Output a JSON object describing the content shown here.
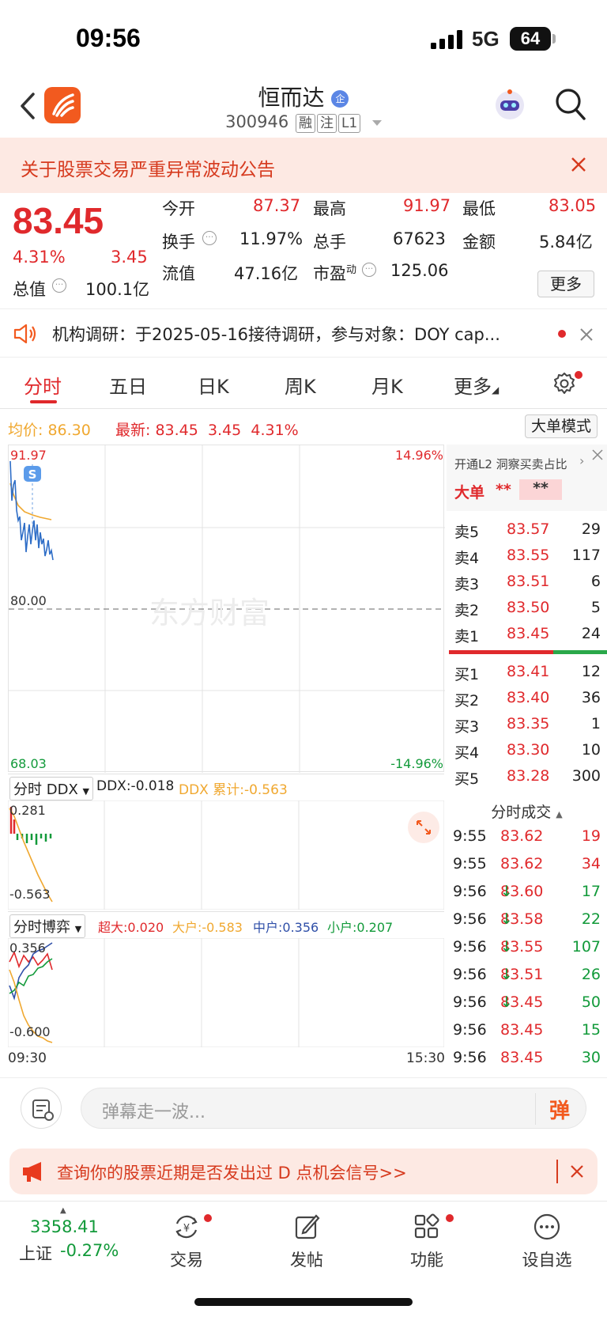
{
  "status_bar": {
    "time": "09:56",
    "network": "5G",
    "battery": "64"
  },
  "header": {
    "stock_name": "恒而达",
    "stock_code": "300946",
    "tags": [
      "融",
      "注",
      "L1"
    ]
  },
  "notice": {
    "text": "关于股票交易严重异常波动公告"
  },
  "quote": {
    "price": "83.45",
    "change_pct": "4.31%",
    "change": "3.45",
    "open_label": "今开",
    "open": "87.37",
    "high_label": "最高",
    "high": "91.97",
    "low_label": "最低",
    "low": "83.05",
    "turnover_label": "换手",
    "turnover": "11.97%",
    "volume_label": "总手",
    "volume": "67623",
    "amount_label": "金额",
    "amount": "5.84亿",
    "mcap_label": "总值",
    "mcap": "100.1亿",
    "float_label": "流值",
    "float_cap": "47.16亿",
    "pe_label": "市盈",
    "pe_sup": "动",
    "pe": "125.06",
    "more_label": "更多"
  },
  "research": {
    "text": "机构调研：于2025-05-16接待调研，参与对象：DOY cap..."
  },
  "tabs": [
    "分时",
    "五日",
    "日K",
    "周K",
    "月K",
    "更多"
  ],
  "legend": {
    "avg_label": "均价:",
    "avg": "86.30",
    "latest_label": "最新:",
    "latest": "83.45",
    "latest_chg": "3.45",
    "latest_pct": "4.31%",
    "mode_button": "大单模式"
  },
  "chart_labels": {
    "top_price": "91.97",
    "top_pct": "14.96%",
    "mid_price": "80.00",
    "bottom_price": "68.03",
    "bottom_pct": "-14.96%",
    "marker": "S",
    "watermark": "东方财富",
    "start_time": "09:30",
    "end_time": "15:30"
  },
  "ddx": {
    "selector": "分时 DDX",
    "ddx_label": "DDX:-0.018",
    "ddx_cum_label": "DDX 累计:-0.563",
    "top": "0.281",
    "bottom": "-0.563"
  },
  "boyi": {
    "selector": "分时博弈",
    "super": "超大:0.020",
    "large": "大户:-0.583",
    "mid": "中户:0.356",
    "small": "小户:0.207",
    "top": "0.356",
    "bottom": "-0.600"
  },
  "side_panel": {
    "l2_text": "开通L2 洞察买卖占比",
    "big_label": "大单",
    "big_v1": "**",
    "big_v2": "**",
    "asks": [
      {
        "label": "卖5",
        "price": "83.57",
        "vol": "29"
      },
      {
        "label": "卖4",
        "price": "83.55",
        "vol": "117"
      },
      {
        "label": "卖3",
        "price": "83.51",
        "vol": "6"
      },
      {
        "label": "卖2",
        "price": "83.50",
        "vol": "5"
      },
      {
        "label": "卖1",
        "price": "83.45",
        "vol": "24"
      }
    ],
    "bids": [
      {
        "label": "买1",
        "price": "83.41",
        "vol": "12"
      },
      {
        "label": "买2",
        "price": "83.40",
        "vol": "36"
      },
      {
        "label": "买3",
        "price": "83.35",
        "vol": "1"
      },
      {
        "label": "买4",
        "price": "83.30",
        "vol": "10"
      },
      {
        "label": "买5",
        "price": "83.28",
        "vol": "300"
      }
    ],
    "trades_title": "分时成交",
    "trades": [
      {
        "time": "9:55",
        "price": "83.62",
        "arrow": "",
        "vol": "19"
      },
      {
        "time": "9:55",
        "price": "83.62",
        "arrow": "",
        "vol": "34"
      },
      {
        "time": "9:56",
        "price": "83.60",
        "arrow": "↓",
        "vol": "17"
      },
      {
        "time": "9:56",
        "price": "83.58",
        "arrow": "↓",
        "vol": "22"
      },
      {
        "time": "9:56",
        "price": "83.55",
        "arrow": "↓",
        "vol": "107"
      },
      {
        "time": "9:56",
        "price": "83.51",
        "arrow": "↓",
        "vol": "26"
      },
      {
        "time": "9:56",
        "price": "83.45",
        "arrow": "↓",
        "vol": "50"
      },
      {
        "time": "9:56",
        "price": "83.45",
        "arrow": "",
        "vol": "15"
      },
      {
        "time": "9:56",
        "price": "83.45",
        "arrow": "",
        "vol": "30"
      }
    ]
  },
  "danmu": {
    "placeholder": "弹幕走一波...",
    "button": "弹"
  },
  "promo": {
    "text": "查询你的股票近期是否发出过 D 点机会信号>>"
  },
  "bottom_nav": {
    "index_value": "3358.41",
    "index_name": "上证",
    "index_change": "-0.27%",
    "items": [
      "交易",
      "发帖",
      "功能",
      "设自选"
    ]
  },
  "colors": {
    "up": "#e0292c",
    "down": "#129a3a",
    "accent": "#f25a1f",
    "avg_line": "#f0a830",
    "price_line": "#2f6ec7"
  }
}
